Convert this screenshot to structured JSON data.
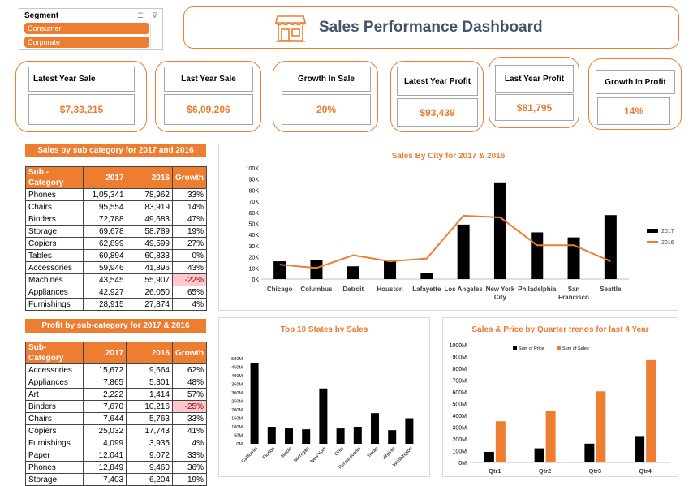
{
  "slicer": {
    "title": "Segment",
    "items": [
      "Consumer",
      "Corporate"
    ],
    "icons": [
      "multi-select-icon",
      "clear-filter-icon"
    ]
  },
  "header": {
    "title": "Sales Performance Dashboard",
    "icon": "store-icon"
  },
  "kpis": [
    {
      "label": "Latest  Year Sale",
      "value": "$7,33,215"
    },
    {
      "label": "Last  Year Sale",
      "value": "$6,09,206"
    },
    {
      "label": "Growth In Sale",
      "value": "20%"
    },
    {
      "label": "Latest Year Profit",
      "value": "$93,439"
    },
    {
      "label": "Last Year  Profit",
      "value": "$81,795"
    },
    {
      "label": "Growth In Profit",
      "value": "14%"
    }
  ],
  "sales_table": {
    "title": "Sales by sub category for 2017 and 2016",
    "columns": [
      "Sub - Category",
      "2017",
      "2016",
      "Growth"
    ],
    "rows": [
      [
        "Phones",
        "1,05,341",
        "78,962",
        "33%"
      ],
      [
        "Chairs",
        "95,554",
        "83,919",
        "14%"
      ],
      [
        "Binders",
        "72,788",
        "49,683",
        "47%"
      ],
      [
        "Storage",
        "69,678",
        "58,789",
        "19%"
      ],
      [
        "Copiers",
        "62,899",
        "49,599",
        "27%"
      ],
      [
        "Tables",
        "60,894",
        "60,833",
        "0%"
      ],
      [
        "Accessories",
        "59,946",
        "41,896",
        "43%"
      ],
      [
        "Machines",
        "43,545",
        "55,907",
        "-22%"
      ],
      [
        "Appliances",
        "42,927",
        "26,050",
        "65%"
      ],
      [
        "Furnishings",
        "28,915",
        "27,874",
        "4%"
      ]
    ]
  },
  "profit_table": {
    "title": "Profit by sub-category for 2017 & 2016",
    "columns": [
      "Sub-Category",
      "2017",
      "2016",
      "Growth"
    ],
    "rows": [
      [
        "Accessories",
        "15,672",
        "9,664",
        "62%"
      ],
      [
        "Appliances",
        "7,865",
        "5,301",
        "48%"
      ],
      [
        "Art",
        "2,222",
        "1,414",
        "57%"
      ],
      [
        "Binders",
        "7,670",
        "10,216",
        "-25%"
      ],
      [
        "Chairs",
        "7,644",
        "5,763",
        "33%"
      ],
      [
        "Copiers",
        "25,032",
        "17,743",
        "41%"
      ],
      [
        "Furnishings",
        "4,099",
        "3,935",
        "4%"
      ],
      [
        "Paper",
        "12,041",
        "9,072",
        "33%"
      ],
      [
        "Phones",
        "12,849",
        "9,460",
        "36%"
      ],
      [
        "Storage",
        "7,403",
        "6,204",
        "19%"
      ]
    ]
  },
  "colors": {
    "accent": "#ed7d31",
    "bar_black": "#000000",
    "negative_fill": "#ffc7ce",
    "title_text": "#44546a"
  },
  "chart_data": [
    {
      "type": "bar",
      "title": "Sales By City for 2017  &  2016",
      "categories": [
        "Chicago",
        "Columbus",
        "Detroit",
        "Houston",
        "Lafayette",
        "Los Angeles",
        "New York City",
        "Philadelphia",
        "San Francisco",
        "Seattle"
      ],
      "category_lines": [
        [
          "Chicago"
        ],
        [
          "Columbus"
        ],
        [
          "Detroit"
        ],
        [
          "Houston"
        ],
        [
          "Lafayette"
        ],
        [
          "Los Angeles"
        ],
        [
          "New York",
          "City"
        ],
        [
          "Philadelphia"
        ],
        [
          "San",
          "Francisco"
        ],
        [
          "Seattle"
        ]
      ],
      "series": [
        {
          "name": "2017",
          "type": "bar",
          "color": "#000000",
          "values": [
            16000,
            17500,
            11500,
            16500,
            5500,
            49000,
            87000,
            42000,
            37500,
            57500
          ]
        },
        {
          "name": "2016",
          "type": "line",
          "color": "#ed7d31",
          "values": [
            13000,
            10000,
            21500,
            16000,
            18500,
            57000,
            55500,
            30500,
            30500,
            16000
          ]
        }
      ],
      "yticks": [
        "0K",
        "10K",
        "20K",
        "30K",
        "40K",
        "50K",
        "60K",
        "70K",
        "80K",
        "90K",
        "100K"
      ],
      "ylim": [
        0,
        100000
      ],
      "legend": "right"
    },
    {
      "type": "bar",
      "title": "Top 10 States by Sales",
      "categories": [
        "California",
        "Florida",
        "Illinois",
        "Michigan",
        "New York",
        "Ohio",
        "Pennsylvania",
        "Texas",
        "Virginia",
        "Washington"
      ],
      "values": [
        475,
        100,
        90,
        85,
        325,
        90,
        100,
        180,
        80,
        150
      ],
      "yticks": [
        "0M",
        "50M",
        "100M",
        "150M",
        "200M",
        "250M",
        "300M",
        "350M",
        "400M",
        "450M",
        "500M"
      ],
      "ylim": [
        0,
        500
      ],
      "color": "#000000"
    },
    {
      "type": "bar",
      "title": "Sales & Price by Quarter trends for last 4  Year",
      "categories": [
        "Qtr1",
        "Qtr2",
        "Qtr3",
        "Qtr4"
      ],
      "series": [
        {
          "name": "Sum of Price",
          "color": "#000000",
          "values": [
            90,
            120,
            160,
            225
          ]
        },
        {
          "name": "Sum of Sales",
          "color": "#ed7d31",
          "values": [
            350,
            440,
            605,
            870
          ]
        }
      ],
      "yticks": [
        "0M",
        "100M",
        "200M",
        "300M",
        "400M",
        "500M",
        "600M",
        "700M",
        "800M",
        "900M",
        "1000M"
      ],
      "ylim": [
        0,
        1000
      ],
      "legend": "top"
    }
  ]
}
